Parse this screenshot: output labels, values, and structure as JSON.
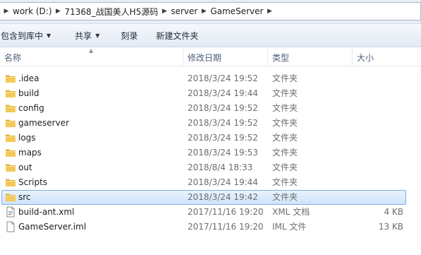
{
  "address": {
    "crumbs": [
      "work (D:)",
      "71368_战国美人H5源码",
      "server",
      "GameServer"
    ]
  },
  "toolbar": {
    "include_library": "包含到库中",
    "share": "共享",
    "burn": "刻录",
    "new_folder": "新建文件夹"
  },
  "columns": {
    "name": "名称",
    "date": "修改日期",
    "type": "类型",
    "size": "大小"
  },
  "files": [
    {
      "name": ".idea",
      "date": "2018/3/24 19:52",
      "type": "文件夹",
      "size": "",
      "icon": "folder-icon"
    },
    {
      "name": "build",
      "date": "2018/3/24 19:44",
      "type": "文件夹",
      "size": "",
      "icon": "folder-icon"
    },
    {
      "name": "config",
      "date": "2018/3/24 19:52",
      "type": "文件夹",
      "size": "",
      "icon": "folder-icon"
    },
    {
      "name": "gameserver",
      "date": "2018/3/24 19:52",
      "type": "文件夹",
      "size": "",
      "icon": "folder-icon"
    },
    {
      "name": "logs",
      "date": "2018/3/24 19:52",
      "type": "文件夹",
      "size": "",
      "icon": "folder-icon"
    },
    {
      "name": "maps",
      "date": "2018/3/24 19:53",
      "type": "文件夹",
      "size": "",
      "icon": "folder-icon"
    },
    {
      "name": "out",
      "date": "2018/8/4 18:33",
      "type": "文件夹",
      "size": "",
      "icon": "folder-icon"
    },
    {
      "name": "Scripts",
      "date": "2018/3/24 19:44",
      "type": "文件夹",
      "size": "",
      "icon": "folder-icon"
    },
    {
      "name": "src",
      "date": "2018/3/24 19:42",
      "type": "文件夹",
      "size": "",
      "icon": "folder-icon",
      "selected": true
    },
    {
      "name": "build-ant.xml",
      "date": "2017/11/16 19:20",
      "type": "XML 文档",
      "size": "4 KB",
      "icon": "xml-file-icon"
    },
    {
      "name": "GameServer.iml",
      "date": "2017/11/16 19:20",
      "type": "IML 文件",
      "size": "13 KB",
      "icon": "file-icon"
    }
  ],
  "colors": {
    "selection_border": "#84acdd",
    "selection_fill": "#cfe4fb",
    "folder": "#f3c95a"
  }
}
